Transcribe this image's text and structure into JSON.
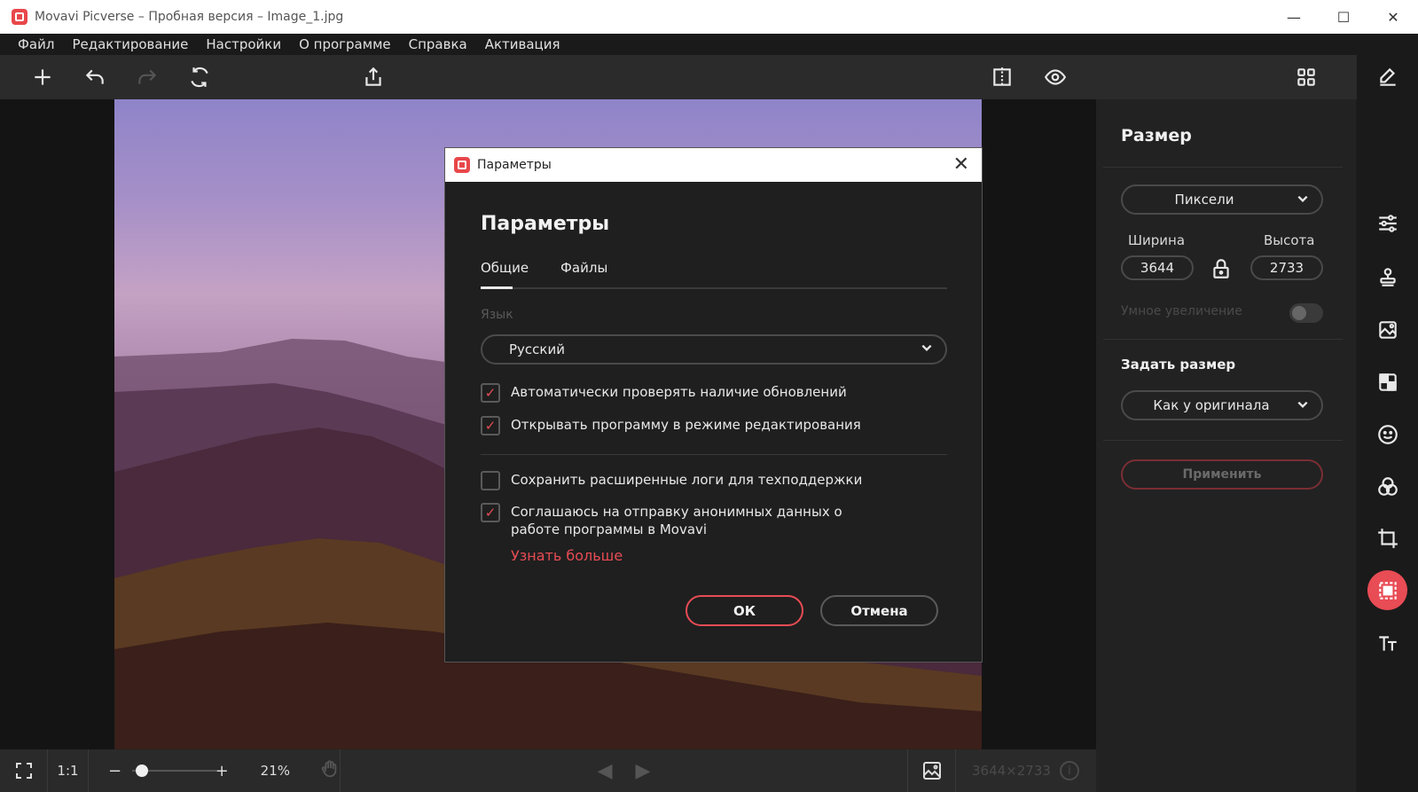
{
  "window": {
    "title": "Movavi Picverse – Пробная версия – Image_1.jpg",
    "minimize": "—",
    "maximize": "☐",
    "close": "✕"
  },
  "menu": [
    "Файл",
    "Редактирование",
    "Настройки",
    "О программе",
    "Справка",
    "Активация"
  ],
  "status": {
    "one_to_one": "1:1",
    "minus": "−",
    "plus": "+",
    "zoom_level": 21,
    "zoom_text": "21%",
    "dimensions": "3644×2733"
  },
  "right_panel": {
    "title": "Размер",
    "unit": "Пиксели",
    "width_label": "Ширина",
    "height_label": "Высота",
    "width": "3644",
    "height": "2733",
    "smart_upscale": "Умное увеличение",
    "set_size_label": "Задать размер",
    "preset": "Как у оригинала",
    "apply": "Применить"
  },
  "dialog": {
    "window_title": "Параметры",
    "heading": "Параметры",
    "tabs": [
      "Общие",
      "Файлы"
    ],
    "language_label": "Язык",
    "language_value": "Русский",
    "checkboxes": [
      {
        "label": "Автоматически проверять наличие обновлений",
        "checked": true
      },
      {
        "label": "Открывать программу в режиме редактирования",
        "checked": true
      },
      {
        "label": "Сохранить расширенные логи для техподдержки",
        "checked": false
      },
      {
        "label": "Соглашаюсь на отправку анонимных данных о работе программы в Movavi",
        "checked": true
      }
    ],
    "learn_more": "Узнать больше",
    "ok": "ОК",
    "cancel": "Отмена"
  },
  "colors": {
    "accent": "#e84c55",
    "background": "#1e1e1e",
    "panel": "#222222"
  }
}
